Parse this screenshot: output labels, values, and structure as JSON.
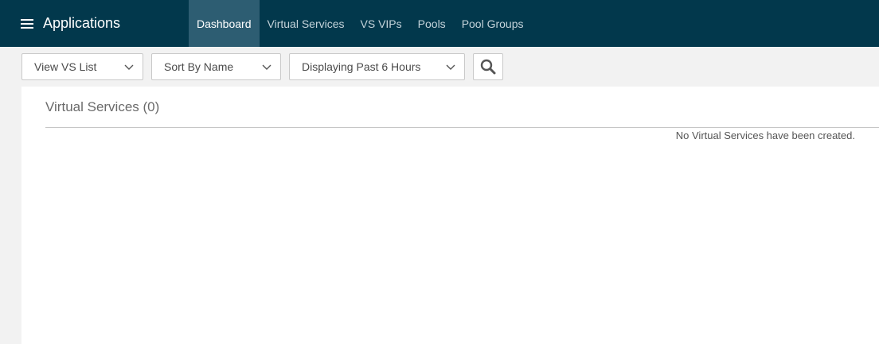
{
  "header": {
    "app_title": "Applications",
    "menu_icon": "hamburger-menu-icon",
    "tabs": [
      {
        "label": "Dashboard",
        "active": true
      },
      {
        "label": "Virtual Services",
        "active": false
      },
      {
        "label": "VS VIPs",
        "active": false
      },
      {
        "label": "Pools",
        "active": false
      },
      {
        "label": "Pool Groups",
        "active": false
      }
    ]
  },
  "toolbar": {
    "view_select": "View VS List",
    "sort_select": "Sort By Name",
    "time_select": "Displaying Past 6 Hours",
    "search_icon": "search-icon"
  },
  "panel": {
    "title": "Virtual Services (0)",
    "empty_message": "No Virtual Services have been created."
  },
  "colors": {
    "header_bg": "#02384c",
    "active_tab_bg": "#2d5d72",
    "page_bg": "#f2f2f2"
  }
}
